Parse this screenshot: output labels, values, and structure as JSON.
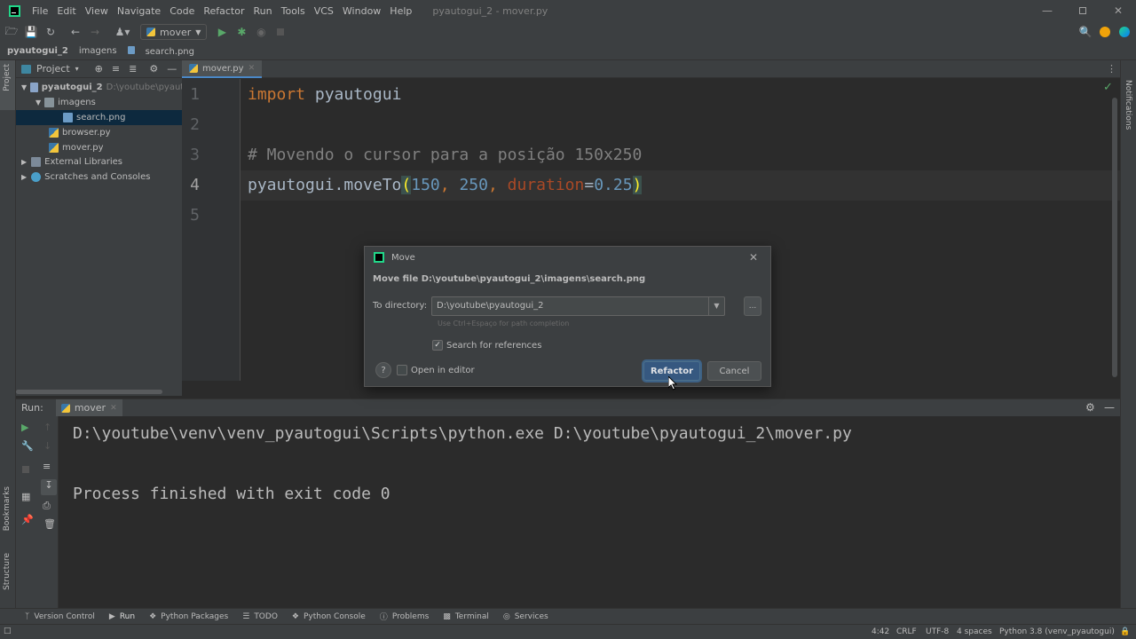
{
  "titlebar": {
    "menu": [
      "File",
      "Edit",
      "View",
      "Navigate",
      "Code",
      "Refactor",
      "Run",
      "Tools",
      "VCS",
      "Window",
      "Help"
    ],
    "window_title": "pyautogui_2 - mover.py"
  },
  "toolbar": {
    "run_config": "mover"
  },
  "breadcrumb": [
    "pyautogui_2",
    "imagens",
    "search.png"
  ],
  "left_strip": {
    "project": "Project",
    "bookmarks": "Bookmarks",
    "structure": "Structure"
  },
  "right_strip": {
    "notifications": "Notifications"
  },
  "project_panel": {
    "title": "Project",
    "tree": [
      {
        "label": "pyautogui_2",
        "hint": "D:\\youtube\\pyautogui"
      },
      {
        "label": "imagens"
      },
      {
        "label": "search.png"
      },
      {
        "label": "browser.py"
      },
      {
        "label": "mover.py"
      },
      {
        "label": "External Libraries"
      },
      {
        "label": "Scratches and Consoles"
      }
    ]
  },
  "editor": {
    "tab": "mover.py",
    "line_numbers": [
      "1",
      "2",
      "3",
      "4",
      "5"
    ],
    "lines": {
      "l1_kw": "import",
      "l1_rest": " pyautogui",
      "l3": "# Movendo o cursor para a posição 150x250",
      "l4_a": "pyautogui.moveTo",
      "l4_open": "(",
      "l4_n1": "150",
      "l4_c1": ", ",
      "l4_n2": "250",
      "l4_c2": ", ",
      "l4_prm": "duration",
      "l4_eq": "=",
      "l4_n3": "0.25",
      "l4_close": ")"
    }
  },
  "run_panel": {
    "label": "Run:",
    "tab": "mover",
    "console": [
      "D:\\youtube\\venv\\venv_pyautogui\\Scripts\\python.exe D:\\youtube\\pyautogui_2\\mover.py",
      "Process finished with exit code 0"
    ]
  },
  "bottom_tools": [
    "Version Control",
    "Run",
    "Python Packages",
    "TODO",
    "Python Console",
    "Problems",
    "Terminal",
    "Services"
  ],
  "status": {
    "position": "4:42",
    "line_sep": "CRLF",
    "encoding": "UTF-8",
    "indent": "4 spaces",
    "interpreter": "Python 3.8 (venv_pyautogui)"
  },
  "dialog": {
    "title": "Move",
    "heading": "Move file D:\\youtube\\pyautogui_2\\imagens\\search.png",
    "to_directory_label": "To directory:",
    "to_directory_value": "D:\\youtube\\pyautogui_2",
    "hint": "Use Ctrl+Espaço for path completion",
    "search_refs_label": "Search for references",
    "search_refs_checked": true,
    "open_in_editor_label": "Open in editor",
    "browse_label": "...",
    "help_label": "?",
    "refactor_label": "Refactor",
    "cancel_label": "Cancel"
  },
  "colors": {
    "accent": "#365880",
    "keyword": "#cc7832",
    "number": "#6897bb",
    "comment": "#808080",
    "param": "#aa4926"
  }
}
